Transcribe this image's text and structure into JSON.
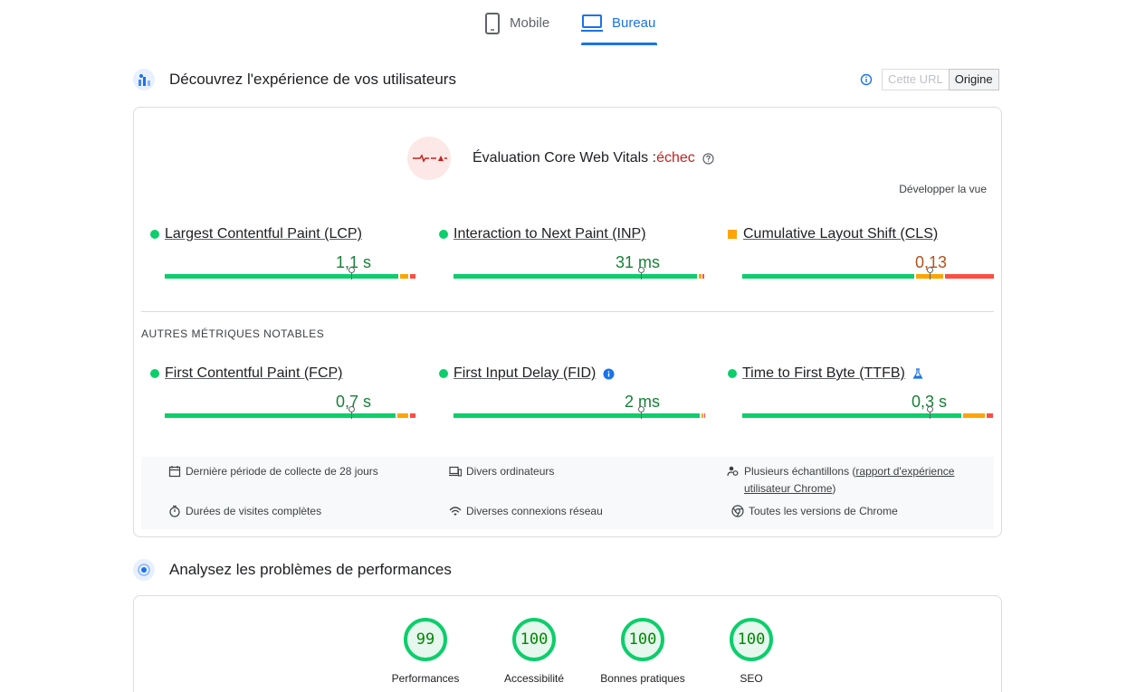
{
  "tabs": {
    "mobile": "Mobile",
    "desktop": "Bureau"
  },
  "crux": {
    "title": "Découvrez l'expérience de vos utilisateurs",
    "toggle": {
      "this_url": "Cette URL",
      "origin": "Origine"
    },
    "assessment": {
      "label": "Évaluation Core Web Vitals :",
      "status": "échec"
    },
    "expand": "Développer la vue",
    "core_metrics": [
      {
        "name": "Largest Contentful Paint (LCP)",
        "value": "1,1 s",
        "rating": "good"
      },
      {
        "name": "Interaction to Next Paint (INP)",
        "value": "31 ms",
        "rating": "good"
      },
      {
        "name": "Cumulative Layout Shift (CLS)",
        "value": "0,13",
        "rating": "average"
      }
    ],
    "other_title": "AUTRES MÉTRIQUES NOTABLES",
    "other_metrics": [
      {
        "name": "First Contentful Paint (FCP)",
        "value": "0,7 s",
        "rating": "good"
      },
      {
        "name": "First Input Delay (FID)",
        "value": "2 ms",
        "rating": "good"
      },
      {
        "name": "Time to First Byte (TTFB)",
        "value": "0,3 s",
        "rating": "good"
      }
    ],
    "footer": {
      "period": "Dernière période de collecte de 28 jours",
      "devices": "Divers ordinateurs",
      "samples_prefix": "Plusieurs échantillons (",
      "samples_link_1": "rapport d'expérience",
      "samples_link_2": "utilisateur Chrome",
      "samples_suffix": ")",
      "duration": "Durées de visites complètes",
      "network": "Diverses connexions réseau",
      "versions": "Toutes les versions de Chrome"
    }
  },
  "lab": {
    "title": "Analysez les problèmes de performances",
    "scores": [
      {
        "value": "99",
        "label": "Performances"
      },
      {
        "value": "100",
        "label": "Accessibilité"
      },
      {
        "value": "100",
        "label": "Bonnes pratiques"
      },
      {
        "value": "100",
        "label": "SEO"
      }
    ]
  },
  "colors": {
    "good": "#0cce6b",
    "average": "#ffa400",
    "poor": "#ff4e42",
    "accent": "#1a73e8",
    "fail": "#c5221f"
  }
}
